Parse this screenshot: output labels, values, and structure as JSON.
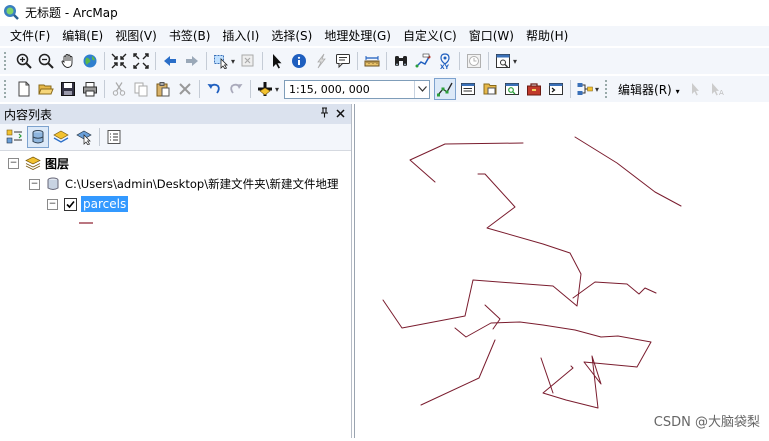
{
  "window": {
    "title": "无标题 - ArcMap"
  },
  "menu": [
    "文件(F)",
    "编辑(E)",
    "视图(V)",
    "书签(B)",
    "插入(I)",
    "选择(S)",
    "地理处理(G)",
    "自定义(C)",
    "窗口(W)",
    "帮助(H)"
  ],
  "toolbar": {
    "scale": "1:15, 000, 000",
    "editor_label": "编辑器(R)"
  },
  "toc": {
    "title": "内容列表",
    "layers_group": "图层",
    "data_path": "C:\\Users\\admin\\Desktop\\新建文件夹\\新建文件地理",
    "layer_name": "parcels",
    "line_color": "#8b1a2b"
  },
  "map": {
    "line_color": "#7a1c2e"
  },
  "watermark": "CSDN @大脑袋梨"
}
